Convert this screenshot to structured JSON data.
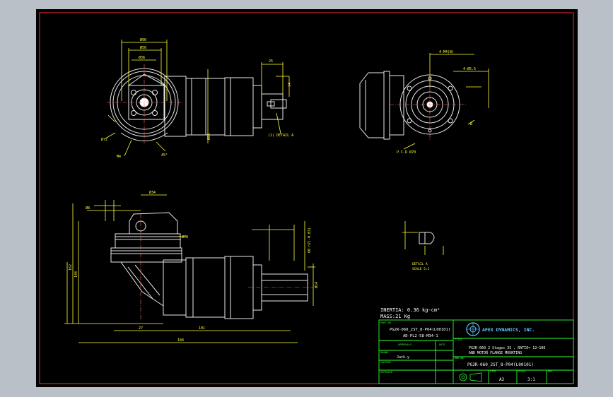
{
  "colors": {
    "background": "#000000",
    "frame": "#ff2a2a",
    "line": "#e8e8e8",
    "dimension": "#ffff33",
    "title_block": "#33ff33",
    "text": "#ffffff",
    "window": "#b9c0c8"
  },
  "notes": {
    "inertia": "INERTIA: 0.36 kg-cm²",
    "mass": "MASS:21 Kg"
  },
  "detail": {
    "label1": "DETAIL A",
    "label2": "SCALE 5:1"
  },
  "view_labels": {
    "detail_ref": "(1) DETAIL A"
  },
  "title_block": {
    "part_no_label": "PART NO.",
    "part_no_line1": "PG2R-060_2ST_8-P04(L00101)",
    "part_no_line2": "AD-PL2-58-M34-1",
    "approval_label": "APPROVALS",
    "date_label": "DATE",
    "drawn_label": "DRAWN",
    "drawn_by": "Jack-y",
    "checked_label": "CHECKED",
    "approved_label": "APPROVED",
    "company": "APEX DYNAMICS, INC.",
    "title_label": "TITLE",
    "title_line1": "PG2R-060_2 Stages_3S , RATIO= 12~100",
    "title_line2": "AND MOTOR FLANGE MOUNTING",
    "dwg_label": "DWG NO.",
    "dwg_no": "PG2R-060_2ST_8-P04(L00101)",
    "size_label": "SIZE",
    "size": "A2",
    "scale_label": "SCALE",
    "scale": "3:1",
    "rev_label": "REV"
  }
}
